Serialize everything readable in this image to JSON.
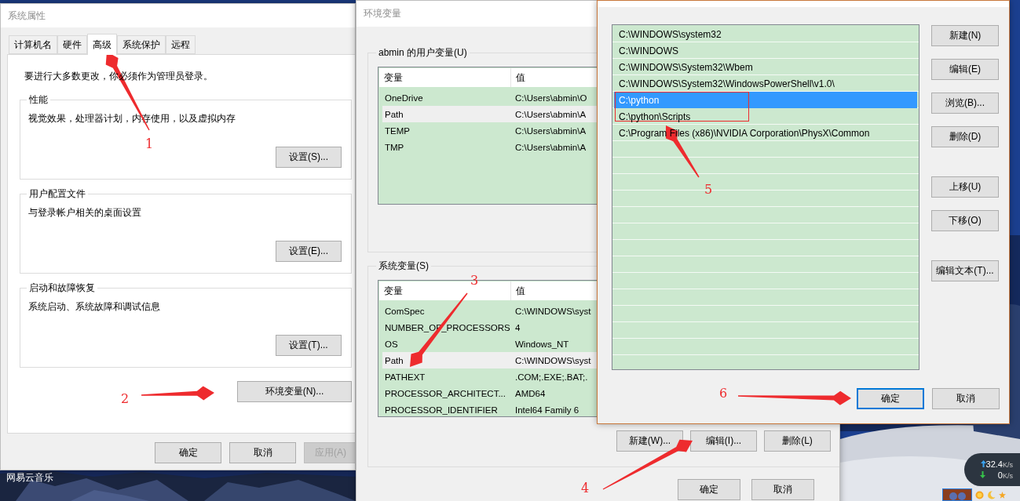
{
  "desktop": {
    "icon_label": "网易云音乐"
  },
  "system_properties": {
    "title": "系统属性",
    "tabs": [
      {
        "label": "计算机名",
        "selected": false
      },
      {
        "label": "硬件",
        "selected": false
      },
      {
        "label": "高级",
        "selected": true
      },
      {
        "label": "系统保护",
        "selected": false
      },
      {
        "label": "远程",
        "selected": false
      }
    ],
    "notice": "要进行大多数更改，你必须作为管理员登录。",
    "groups": [
      {
        "title": "性能",
        "description": "视觉效果，处理器计划，内存使用，以及虚拟内存",
        "button": "设置(S)..."
      },
      {
        "title": "用户配置文件",
        "description": "与登录帐户相关的桌面设置",
        "button": "设置(E)..."
      },
      {
        "title": "启动和故障恢复",
        "description": "系统启动、系统故障和调试信息",
        "button": "设置(T)..."
      }
    ],
    "env_button": "环境变量(N)...",
    "buttons": [
      {
        "label": "确定",
        "disabled": false
      },
      {
        "label": "取消",
        "disabled": false
      },
      {
        "label": "应用(A)",
        "disabled": true
      }
    ]
  },
  "environment_variables": {
    "title": "环境变量",
    "user_group": {
      "title": "abmin 的用户变量(U)",
      "columns": [
        "变量",
        "值"
      ],
      "rows": [
        {
          "name": "OneDrive",
          "value": "C:\\Users\\abmin\\O",
          "selected": false
        },
        {
          "name": "Path",
          "value": "C:\\Users\\abmin\\A",
          "selected": true
        },
        {
          "name": "TEMP",
          "value": "C:\\Users\\abmin\\A",
          "selected": false
        },
        {
          "name": "TMP",
          "value": "C:\\Users\\abmin\\A",
          "selected": false
        }
      ]
    },
    "system_group": {
      "title": "系统变量(S)",
      "columns": [
        "变量",
        "值"
      ],
      "rows": [
        {
          "name": "ComSpec",
          "value": "C:\\WINDOWS\\syst",
          "selected": false
        },
        {
          "name": "NUMBER_OF_PROCESSORS",
          "value": "4",
          "selected": false
        },
        {
          "name": "OS",
          "value": "Windows_NT",
          "selected": false
        },
        {
          "name": "Path",
          "value": "C:\\WINDOWS\\syst",
          "selected": true
        },
        {
          "name": "PATHEXT",
          "value": ".COM;.EXE;.BAT;.",
          "selected": false
        },
        {
          "name": "PROCESSOR_ARCHITECT...",
          "value": "AMD64",
          "selected": false
        },
        {
          "name": "PROCESSOR_IDENTIFIER",
          "value": "Intel64 Family 6",
          "selected": false
        }
      ]
    },
    "system_buttons": [
      "新建(W)...",
      "编辑(I)...",
      "删除(L)"
    ],
    "buttons": [
      "确定",
      "取消"
    ]
  },
  "edit_path": {
    "entries": [
      {
        "path": "C:\\WINDOWS\\system32",
        "selected": false
      },
      {
        "path": "C:\\WINDOWS",
        "selected": false
      },
      {
        "path": "C:\\WINDOWS\\System32\\Wbem",
        "selected": false
      },
      {
        "path": "C:\\WINDOWS\\System32\\WindowsPowerShell\\v1.0\\",
        "selected": false
      },
      {
        "path": "C:\\python",
        "selected": true
      },
      {
        "path": "C:\\python\\Scripts",
        "selected": false
      },
      {
        "path": "C:\\Program Files (x86)\\NVIDIA Corporation\\PhysX\\Common",
        "selected": false
      }
    ],
    "side_buttons": [
      [
        "新建(N)",
        "编辑(E)",
        "浏览(B)...",
        "删除(D)"
      ],
      [
        "上移(U)",
        "下移(O)"
      ],
      [
        "编辑文本(T)..."
      ]
    ],
    "buttons": [
      {
        "label": "确定",
        "focused": true
      },
      {
        "label": "取消",
        "focused": false
      }
    ]
  },
  "network_widget": {
    "upload": "32.4",
    "upload_unit": "K/s",
    "download": "0",
    "download_unit": "K/s"
  },
  "annotations": [
    {
      "label": "1"
    },
    {
      "label": "2"
    },
    {
      "label": "3"
    },
    {
      "label": "4"
    },
    {
      "label": "5"
    },
    {
      "label": "6"
    }
  ]
}
